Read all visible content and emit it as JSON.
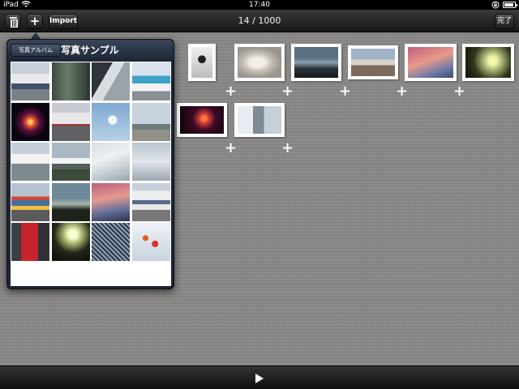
{
  "status_bar": {
    "device": "iPad",
    "time": "17:40",
    "battery_level": 0.9
  },
  "toolbar": {
    "import_label": "Import",
    "counter": "14 / 1000",
    "done_label": "完了",
    "add_label": "+",
    "trash_icon": "trash-icon"
  },
  "popover": {
    "back_label": "写真アルバム",
    "title": "写真サンプル",
    "photos": [
      "p-train1",
      "p-street",
      "p-bldg",
      "p-train2",
      "p-fw",
      "p-train3",
      "p-plane1",
      "p-plane2",
      "p-plane3",
      "p-plane4",
      "p-plane5",
      "p-plane6",
      "p-shop",
      "p-dusk2",
      "p-pink2",
      "p-train4",
      "p-train5",
      "p-sun2",
      "p-grid",
      "p-leaves"
    ]
  },
  "canvas": {
    "photos": [
      "p-bw",
      "p-blond",
      "p-dusk",
      "p-city",
      "p-pink",
      "p-sun",
      "p-fire",
      "p-tower"
    ],
    "add_label": "+"
  },
  "bottom_bar": {
    "play_icon": "play-icon"
  }
}
